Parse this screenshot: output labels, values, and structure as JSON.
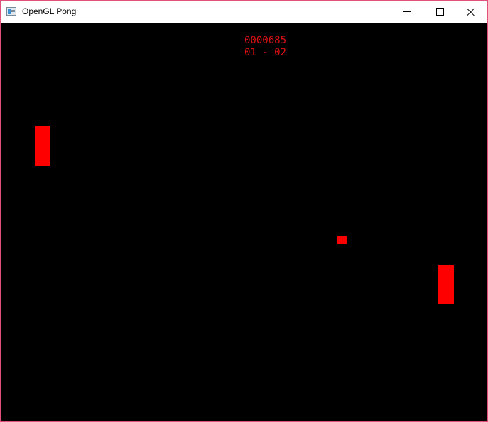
{
  "window": {
    "title": "OpenGL Pong"
  },
  "icons": {
    "app": "window-app-icon",
    "minimize": "minimize-icon",
    "maximize": "maximize-icon",
    "close": "close-icon"
  },
  "hud": {
    "score": "0000685",
    "sets": "01 - 02"
  },
  "colors": {
    "background": "#000000",
    "accent": "#ff0000",
    "hud_text": "#e01010",
    "net": "#c00000"
  }
}
